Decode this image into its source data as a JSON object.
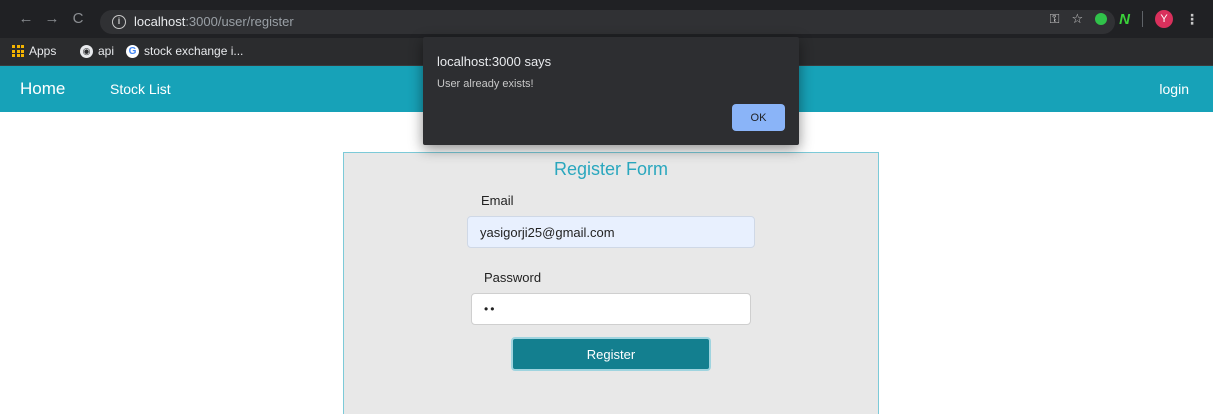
{
  "browser": {
    "url_host": "localhost",
    "url_path": ":3000/user/register",
    "nav_back": "←",
    "nav_forward": "→",
    "nav_reload": "C",
    "profile_initial": "Y",
    "bookmarks": [
      {
        "label": "Apps",
        "icon": "apps-grid-icon"
      },
      {
        "label": "api",
        "icon": "globe-icon"
      },
      {
        "label": "stock exchange i...",
        "icon": "google-icon"
      }
    ]
  },
  "navbar": {
    "home": "Home",
    "stock_list": "Stock List",
    "login": "login"
  },
  "form": {
    "title": "Register Form",
    "email_label": "Email",
    "email_value": "yasigorji25@gmail.com",
    "password_label": "Password",
    "password_value": "••",
    "submit_label": "Register"
  },
  "dialog": {
    "title": "localhost:3000 says",
    "message": "User already exists!",
    "ok_label": "OK"
  },
  "colors": {
    "navbar": "#17a2b8",
    "form_title": "#2aa7be",
    "register_button": "#137f8f",
    "dialog_ok": "#8ab4f8"
  }
}
